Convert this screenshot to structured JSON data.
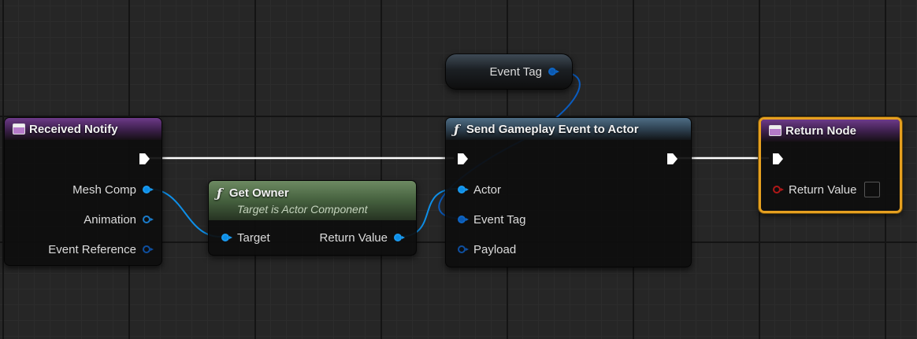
{
  "graph": {
    "nodes": {
      "received_notify": {
        "title": "Received Notify",
        "outputs": [
          "Mesh Comp",
          "Animation",
          "Event Reference"
        ]
      },
      "get_owner": {
        "title": "Get Owner",
        "subtitle": "Target is Actor Component",
        "input": "Target",
        "output": "Return Value"
      },
      "event_tag": {
        "label": "Event Tag"
      },
      "send_event": {
        "title": "Send Gameplay Event to Actor",
        "inputs": [
          "Actor",
          "Event Tag",
          "Payload"
        ]
      },
      "return_node": {
        "title": "Return Node",
        "input": "Return Value"
      }
    }
  },
  "colors": {
    "object_pin": "#0c8de6",
    "struct_pin": "#0a58b0",
    "bool_pin": "#b01818",
    "function_header": "#4e6d85",
    "pure_function_header": "#6d8a62",
    "event_header": "#6d3a89",
    "selection_outline": "#e6a020",
    "exec_wire": "#ffffff"
  },
  "icons": {
    "function": "f",
    "event": "window-icon"
  }
}
